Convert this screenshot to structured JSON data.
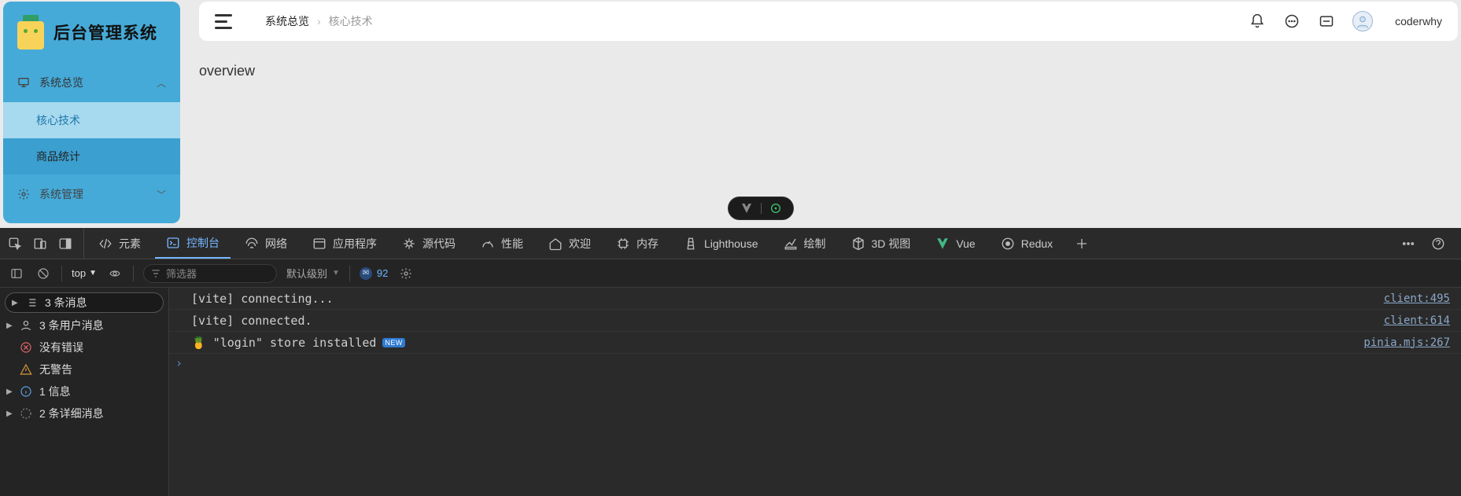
{
  "app": {
    "logo_title": "后台管理系统",
    "menu": {
      "group_overview": "系统总览",
      "sub_core_tech": "核心技术",
      "sub_product_stats": "商品统计",
      "group_sysmgr": "系统管理"
    }
  },
  "topbar": {
    "crumb_main": "系统总览",
    "crumb_sub": "核心技术",
    "username": "coderwhy"
  },
  "page": {
    "body_text": "overview"
  },
  "devtools": {
    "tabs": {
      "elements": "元素",
      "console": "控制台",
      "network": "网络",
      "application": "应用程序",
      "sources": "源代码",
      "performance": "性能",
      "welcome": "欢迎",
      "memory": "内存",
      "lighthouse": "Lighthouse",
      "rendering": "绘制",
      "3dview": "3D 视图",
      "vue": "Vue",
      "redux": "Redux"
    },
    "toolbar": {
      "context": "top",
      "filter_placeholder": "筛选器",
      "level_label": "默认级别",
      "issue_count": "92"
    },
    "sidebar": {
      "messages": "3 条消息",
      "user_messages": "3 条用户消息",
      "no_errors": "没有错误",
      "no_warnings": "无警告",
      "info": "1 信息",
      "verbose": "2 条详细消息"
    },
    "logs": [
      {
        "text": "[vite] connecting...",
        "src": "client:495"
      },
      {
        "text": "[vite] connected.",
        "src": "client:614"
      },
      {
        "text": "🍍  \"login\" store installed",
        "src": "pinia.mjs:267",
        "new_badge": "NEW"
      }
    ]
  }
}
